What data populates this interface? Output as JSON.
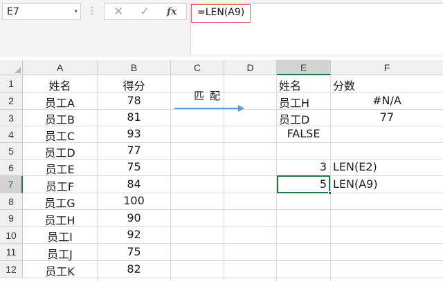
{
  "formula_bar": {
    "name_box": "E7",
    "name_box_arrow": "▾",
    "separator": "⋮",
    "cancel_icon": "✕",
    "enter_icon": "✓",
    "fx_label": "fx",
    "formula": "=LEN(A9)"
  },
  "columns": [
    "A",
    "B",
    "C",
    "D",
    "E",
    "F"
  ],
  "rows": [
    "1",
    "2",
    "3",
    "4",
    "5",
    "6",
    "7",
    "8",
    "9",
    "10",
    "11",
    "12"
  ],
  "selected_cell": "E7",
  "sheet": {
    "A": [
      "姓名",
      "员工A",
      "员工B",
      "员工C",
      "员工D",
      "员工E",
      "员工F",
      "员工G",
      "员工H",
      "员工I",
      "员工J",
      "员工K"
    ],
    "B": [
      "得分",
      "78",
      "81",
      "93",
      "77",
      "75",
      "84",
      "100",
      "90",
      "92",
      "75",
      "82"
    ],
    "C2": "匹配",
    "E1": "姓名",
    "F1": "分数",
    "E2": "员工H",
    "F2": "#N/A",
    "E3": "员工D",
    "F3": "77",
    "E4": "FALSE",
    "E6": "3",
    "F6": "LEN(E2)",
    "E7": "5",
    "F7": "LEN(A9)"
  },
  "colors": {
    "accent": "#217346",
    "arrow": "#5b9bd5",
    "formula_highlight": "#e06c6c"
  }
}
